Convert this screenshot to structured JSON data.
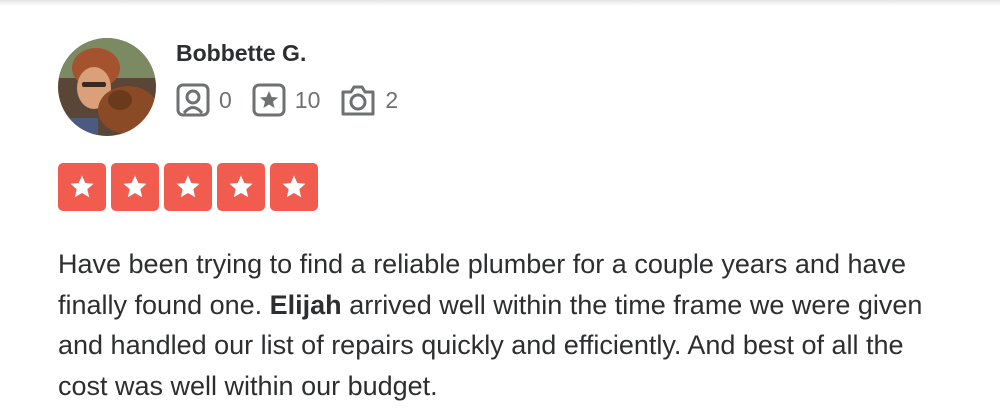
{
  "reviewer": {
    "name": "Bobbette G.",
    "avatar_icon": "user-photo"
  },
  "stats": [
    {
      "icon": "friends-icon",
      "value": "0"
    },
    {
      "icon": "reviews-icon",
      "value": "10"
    },
    {
      "icon": "photos-icon",
      "value": "2"
    }
  ],
  "rating": {
    "value": 5,
    "max": 5,
    "color": "#f15c4f"
  },
  "review": {
    "text_before": "Have been trying to find a reliable plumber for a couple years and have finally found one. ",
    "highlight": "Elijah",
    "text_after": " arrived well within the time frame we were given and handled our list of repairs quickly and efficiently. And best of all the cost was well within our budget."
  }
}
